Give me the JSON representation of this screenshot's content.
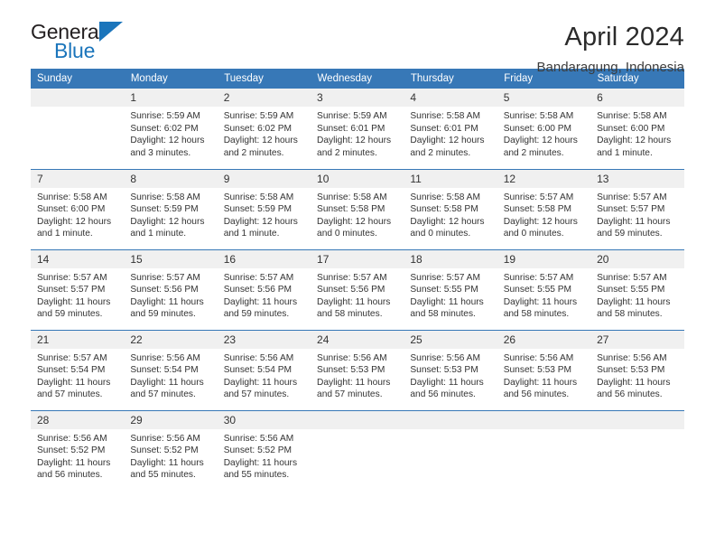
{
  "brand": {
    "name_top": "General",
    "name_bottom": "Blue",
    "accent_color": "#1b75bb"
  },
  "header": {
    "title": "April 2024",
    "subtitle": "Bandaragung, Indonesia",
    "header_bg_color": "#3778b7",
    "daynum_bg_color": "#f0f0f0"
  },
  "weekday_headers": [
    "Sunday",
    "Monday",
    "Tuesday",
    "Wednesday",
    "Thursday",
    "Friday",
    "Saturday"
  ],
  "weeks": [
    [
      {
        "day": "",
        "blank": true,
        "sunrise": "",
        "sunset": "",
        "daylight_line1": "",
        "daylight_line2": ""
      },
      {
        "day": "1",
        "blank": false,
        "sunrise": "Sunrise: 5:59 AM",
        "sunset": "Sunset: 6:02 PM",
        "daylight_line1": "Daylight: 12 hours",
        "daylight_line2": "and 3 minutes."
      },
      {
        "day": "2",
        "blank": false,
        "sunrise": "Sunrise: 5:59 AM",
        "sunset": "Sunset: 6:02 PM",
        "daylight_line1": "Daylight: 12 hours",
        "daylight_line2": "and 2 minutes."
      },
      {
        "day": "3",
        "blank": false,
        "sunrise": "Sunrise: 5:59 AM",
        "sunset": "Sunset: 6:01 PM",
        "daylight_line1": "Daylight: 12 hours",
        "daylight_line2": "and 2 minutes."
      },
      {
        "day": "4",
        "blank": false,
        "sunrise": "Sunrise: 5:58 AM",
        "sunset": "Sunset: 6:01 PM",
        "daylight_line1": "Daylight: 12 hours",
        "daylight_line2": "and 2 minutes."
      },
      {
        "day": "5",
        "blank": false,
        "sunrise": "Sunrise: 5:58 AM",
        "sunset": "Sunset: 6:00 PM",
        "daylight_line1": "Daylight: 12 hours",
        "daylight_line2": "and 2 minutes."
      },
      {
        "day": "6",
        "blank": false,
        "sunrise": "Sunrise: 5:58 AM",
        "sunset": "Sunset: 6:00 PM",
        "daylight_line1": "Daylight: 12 hours",
        "daylight_line2": "and 1 minute."
      }
    ],
    [
      {
        "day": "7",
        "blank": false,
        "sunrise": "Sunrise: 5:58 AM",
        "sunset": "Sunset: 6:00 PM",
        "daylight_line1": "Daylight: 12 hours",
        "daylight_line2": "and 1 minute."
      },
      {
        "day": "8",
        "blank": false,
        "sunrise": "Sunrise: 5:58 AM",
        "sunset": "Sunset: 5:59 PM",
        "daylight_line1": "Daylight: 12 hours",
        "daylight_line2": "and 1 minute."
      },
      {
        "day": "9",
        "blank": false,
        "sunrise": "Sunrise: 5:58 AM",
        "sunset": "Sunset: 5:59 PM",
        "daylight_line1": "Daylight: 12 hours",
        "daylight_line2": "and 1 minute."
      },
      {
        "day": "10",
        "blank": false,
        "sunrise": "Sunrise: 5:58 AM",
        "sunset": "Sunset: 5:58 PM",
        "daylight_line1": "Daylight: 12 hours",
        "daylight_line2": "and 0 minutes."
      },
      {
        "day": "11",
        "blank": false,
        "sunrise": "Sunrise: 5:58 AM",
        "sunset": "Sunset: 5:58 PM",
        "daylight_line1": "Daylight: 12 hours",
        "daylight_line2": "and 0 minutes."
      },
      {
        "day": "12",
        "blank": false,
        "sunrise": "Sunrise: 5:57 AM",
        "sunset": "Sunset: 5:58 PM",
        "daylight_line1": "Daylight: 12 hours",
        "daylight_line2": "and 0 minutes."
      },
      {
        "day": "13",
        "blank": false,
        "sunrise": "Sunrise: 5:57 AM",
        "sunset": "Sunset: 5:57 PM",
        "daylight_line1": "Daylight: 11 hours",
        "daylight_line2": "and 59 minutes."
      }
    ],
    [
      {
        "day": "14",
        "blank": false,
        "sunrise": "Sunrise: 5:57 AM",
        "sunset": "Sunset: 5:57 PM",
        "daylight_line1": "Daylight: 11 hours",
        "daylight_line2": "and 59 minutes."
      },
      {
        "day": "15",
        "blank": false,
        "sunrise": "Sunrise: 5:57 AM",
        "sunset": "Sunset: 5:56 PM",
        "daylight_line1": "Daylight: 11 hours",
        "daylight_line2": "and 59 minutes."
      },
      {
        "day": "16",
        "blank": false,
        "sunrise": "Sunrise: 5:57 AM",
        "sunset": "Sunset: 5:56 PM",
        "daylight_line1": "Daylight: 11 hours",
        "daylight_line2": "and 59 minutes."
      },
      {
        "day": "17",
        "blank": false,
        "sunrise": "Sunrise: 5:57 AM",
        "sunset": "Sunset: 5:56 PM",
        "daylight_line1": "Daylight: 11 hours",
        "daylight_line2": "and 58 minutes."
      },
      {
        "day": "18",
        "blank": false,
        "sunrise": "Sunrise: 5:57 AM",
        "sunset": "Sunset: 5:55 PM",
        "daylight_line1": "Daylight: 11 hours",
        "daylight_line2": "and 58 minutes."
      },
      {
        "day": "19",
        "blank": false,
        "sunrise": "Sunrise: 5:57 AM",
        "sunset": "Sunset: 5:55 PM",
        "daylight_line1": "Daylight: 11 hours",
        "daylight_line2": "and 58 minutes."
      },
      {
        "day": "20",
        "blank": false,
        "sunrise": "Sunrise: 5:57 AM",
        "sunset": "Sunset: 5:55 PM",
        "daylight_line1": "Daylight: 11 hours",
        "daylight_line2": "and 58 minutes."
      }
    ],
    [
      {
        "day": "21",
        "blank": false,
        "sunrise": "Sunrise: 5:57 AM",
        "sunset": "Sunset: 5:54 PM",
        "daylight_line1": "Daylight: 11 hours",
        "daylight_line2": "and 57 minutes."
      },
      {
        "day": "22",
        "blank": false,
        "sunrise": "Sunrise: 5:56 AM",
        "sunset": "Sunset: 5:54 PM",
        "daylight_line1": "Daylight: 11 hours",
        "daylight_line2": "and 57 minutes."
      },
      {
        "day": "23",
        "blank": false,
        "sunrise": "Sunrise: 5:56 AM",
        "sunset": "Sunset: 5:54 PM",
        "daylight_line1": "Daylight: 11 hours",
        "daylight_line2": "and 57 minutes."
      },
      {
        "day": "24",
        "blank": false,
        "sunrise": "Sunrise: 5:56 AM",
        "sunset": "Sunset: 5:53 PM",
        "daylight_line1": "Daylight: 11 hours",
        "daylight_line2": "and 57 minutes."
      },
      {
        "day": "25",
        "blank": false,
        "sunrise": "Sunrise: 5:56 AM",
        "sunset": "Sunset: 5:53 PM",
        "daylight_line1": "Daylight: 11 hours",
        "daylight_line2": "and 56 minutes."
      },
      {
        "day": "26",
        "blank": false,
        "sunrise": "Sunrise: 5:56 AM",
        "sunset": "Sunset: 5:53 PM",
        "daylight_line1": "Daylight: 11 hours",
        "daylight_line2": "and 56 minutes."
      },
      {
        "day": "27",
        "blank": false,
        "sunrise": "Sunrise: 5:56 AM",
        "sunset": "Sunset: 5:53 PM",
        "daylight_line1": "Daylight: 11 hours",
        "daylight_line2": "and 56 minutes."
      }
    ],
    [
      {
        "day": "28",
        "blank": false,
        "sunrise": "Sunrise: 5:56 AM",
        "sunset": "Sunset: 5:52 PM",
        "daylight_line1": "Daylight: 11 hours",
        "daylight_line2": "and 56 minutes."
      },
      {
        "day": "29",
        "blank": false,
        "sunrise": "Sunrise: 5:56 AM",
        "sunset": "Sunset: 5:52 PM",
        "daylight_line1": "Daylight: 11 hours",
        "daylight_line2": "and 55 minutes."
      },
      {
        "day": "30",
        "blank": false,
        "sunrise": "Sunrise: 5:56 AM",
        "sunset": "Sunset: 5:52 PM",
        "daylight_line1": "Daylight: 11 hours",
        "daylight_line2": "and 55 minutes."
      },
      {
        "day": "",
        "blank": true,
        "sunrise": "",
        "sunset": "",
        "daylight_line1": "",
        "daylight_line2": ""
      },
      {
        "day": "",
        "blank": true,
        "sunrise": "",
        "sunset": "",
        "daylight_line1": "",
        "daylight_line2": ""
      },
      {
        "day": "",
        "blank": true,
        "sunrise": "",
        "sunset": "",
        "daylight_line1": "",
        "daylight_line2": ""
      },
      {
        "day": "",
        "blank": true,
        "sunrise": "",
        "sunset": "",
        "daylight_line1": "",
        "daylight_line2": ""
      }
    ]
  ]
}
